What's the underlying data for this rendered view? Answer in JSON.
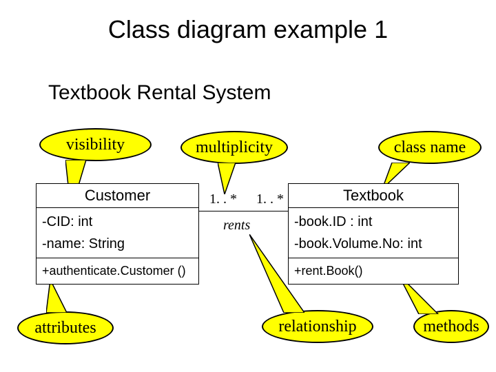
{
  "title": "Class diagram example 1",
  "subtitle": "Textbook Rental System",
  "callouts": {
    "visibility": "visibility",
    "multiplicity": "multiplicity",
    "classname": "class name",
    "attributes": "attributes",
    "relationship": "relationship",
    "methods": "methods"
  },
  "classes": {
    "customer": {
      "name": "Customer",
      "attrs": [
        "-CID:  int",
        "-name:  String"
      ],
      "methods": [
        "+authenticate.Customer ()"
      ]
    },
    "textbook": {
      "name": "Textbook",
      "attrs": [
        "-book.ID : int",
        "-book.Volume.No:  int"
      ],
      "methods": [
        "+rent.Book()"
      ]
    }
  },
  "association": {
    "label": "rents",
    "mult_left": "1. . *",
    "mult_right": "1. . *"
  }
}
